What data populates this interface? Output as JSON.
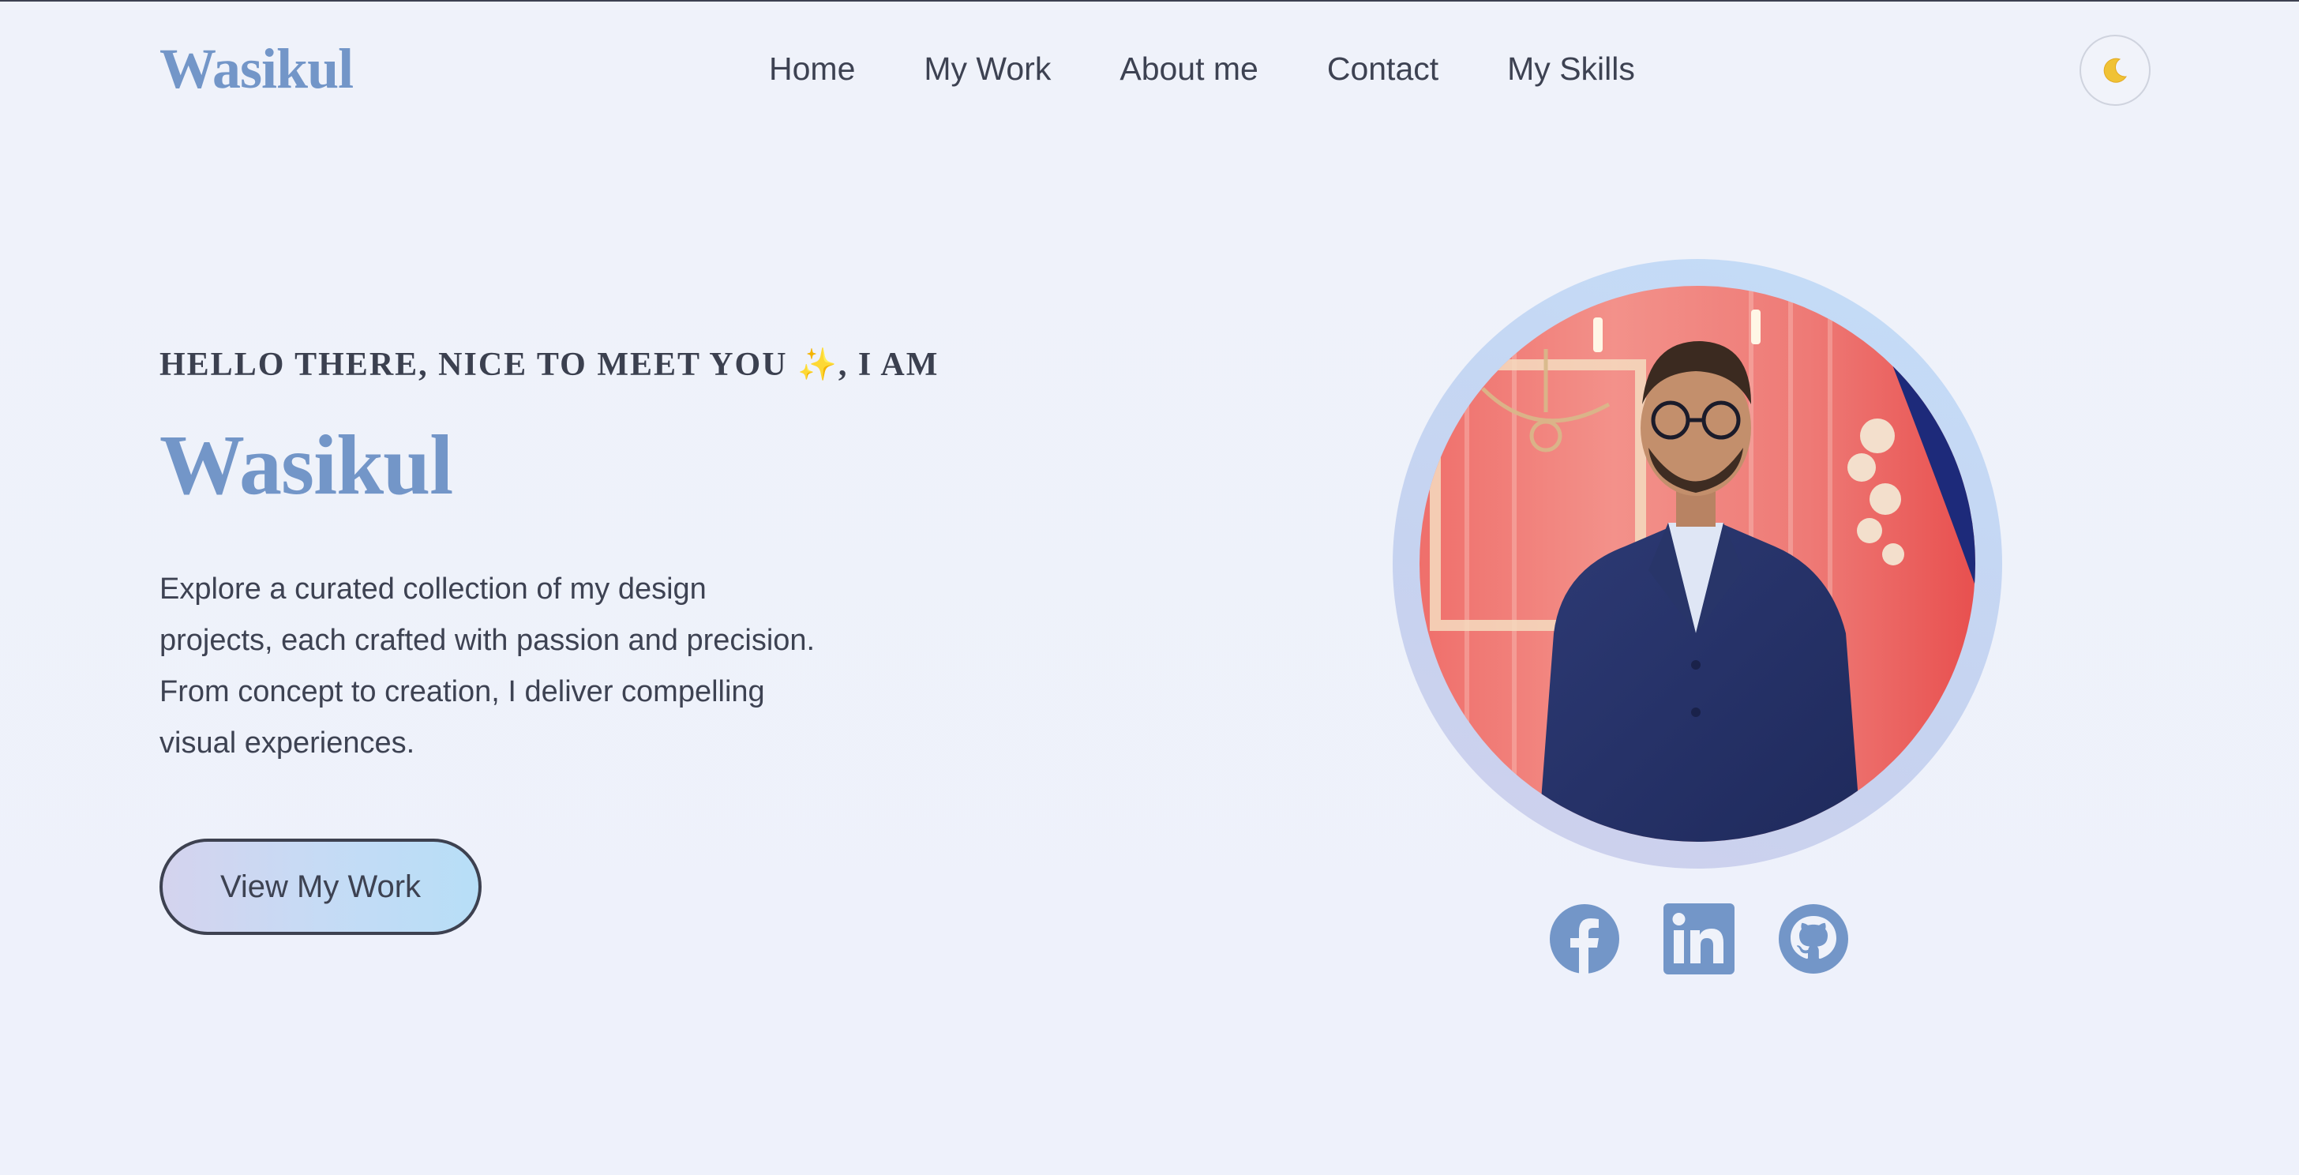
{
  "nav": {
    "brand": "Wasikul",
    "links": [
      "Home",
      "My Work",
      "About me",
      "Contact",
      "My Skills"
    ],
    "theme_toggle_icon": "moon-icon"
  },
  "hero": {
    "greeting_text": "HELLO THERE, NICE TO MEET YOU ",
    "greeting_emoji": "✨",
    "greeting_suffix": ", I AM",
    "name": "Wasikul",
    "description_lines": [
      "Explore a curated collection of my design",
      "projects, each crafted with passion and precision.",
      "From concept to creation, I deliver compelling",
      "visual experiences."
    ],
    "cta_label": "View My Work"
  },
  "social": {
    "icons": [
      "facebook-icon",
      "linkedin-icon",
      "github-icon"
    ]
  },
  "colors": {
    "accent": "#7396c8",
    "text": "#3d4252",
    "background": "#eff2fa",
    "ring": "#c4ddf8"
  }
}
